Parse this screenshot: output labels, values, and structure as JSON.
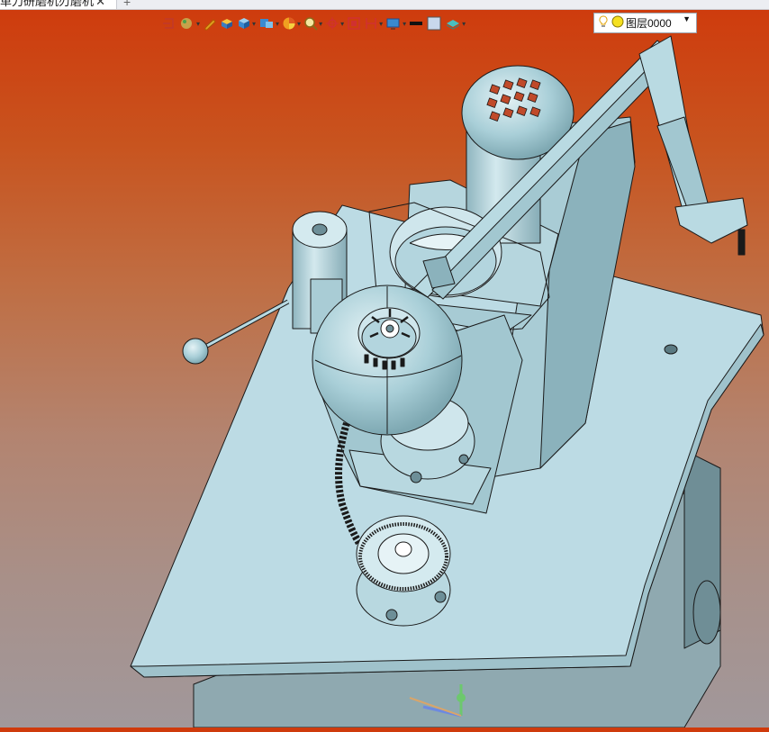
{
  "tab": {
    "title": "单刀研磨机刃磨机",
    "close_icon": "close-icon"
  },
  "new_tab": "+",
  "toolbar": {
    "items": [
      "exit-sketch-icon",
      "render-style-icon",
      "pen-icon",
      "solid-box-icon",
      "view-cube-icon",
      "iso-view-icon",
      "color-wheel-icon",
      "zoom-icon",
      "snap-icon",
      "fit-view-icon",
      "measure-icon",
      "display-icon",
      "line-color-icon",
      "fill-color-icon",
      "layer-stack-icon"
    ]
  },
  "layer_select": {
    "value": "图层0000"
  },
  "viewport": {
    "content": "3D CAD model of tool grinding machine"
  },
  "colors": {
    "bg_top": "#cf3a0c",
    "bg_bottom": "#a1989b",
    "model": "#b9dae2"
  }
}
